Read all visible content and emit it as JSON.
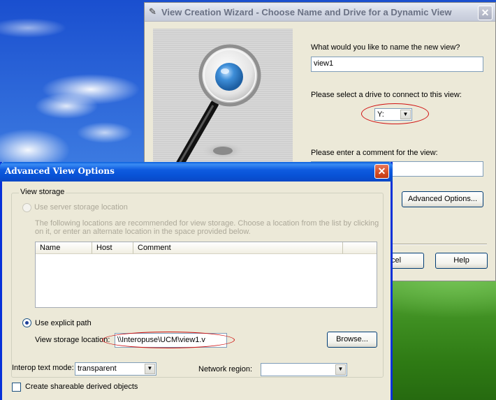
{
  "wizard": {
    "title": "View Creation Wizard - Choose Name and Drive for a Dynamic View",
    "name_prompt": "What would you like to name the new view?",
    "name_value": "view1",
    "drive_prompt": "Please select a drive to connect to this view:",
    "drive_value": "Y:",
    "comment_prompt": "Please enter a comment for the view:",
    "comment_value": "",
    "advanced_button": "Advanced Options...",
    "cancel_button": "Cancel",
    "help_button": "Help"
  },
  "advanced": {
    "title": "Advanced View Options",
    "group_caption": "View storage",
    "server_storage_label": "Use server storage location",
    "server_storage_desc_1": "The following locations are recommended for view storage. Choose a location from the list by clicking",
    "server_storage_desc_2": "on it, or enter an alternate location in the space provided below.",
    "columns": [
      "Name",
      "Host",
      "Comment",
      ""
    ],
    "rows": [],
    "explicit_path_label": "Use explicit path",
    "storage_location_label": "View storage location:",
    "storage_location_value": "\\\\Interopuse\\UCM\\view1.v",
    "browse_button": "Browse...",
    "interop_label": "Interop text mode:",
    "interop_value": "transparent",
    "network_label": "Network region:",
    "network_value": "",
    "shareable_label": "Create shareable derived objects",
    "shareable_checked": false
  },
  "colors": {
    "xp_title_blue": "#0a5edc",
    "highlight_ellipse": "#d01010",
    "dialog_face": "#ece9d8"
  }
}
